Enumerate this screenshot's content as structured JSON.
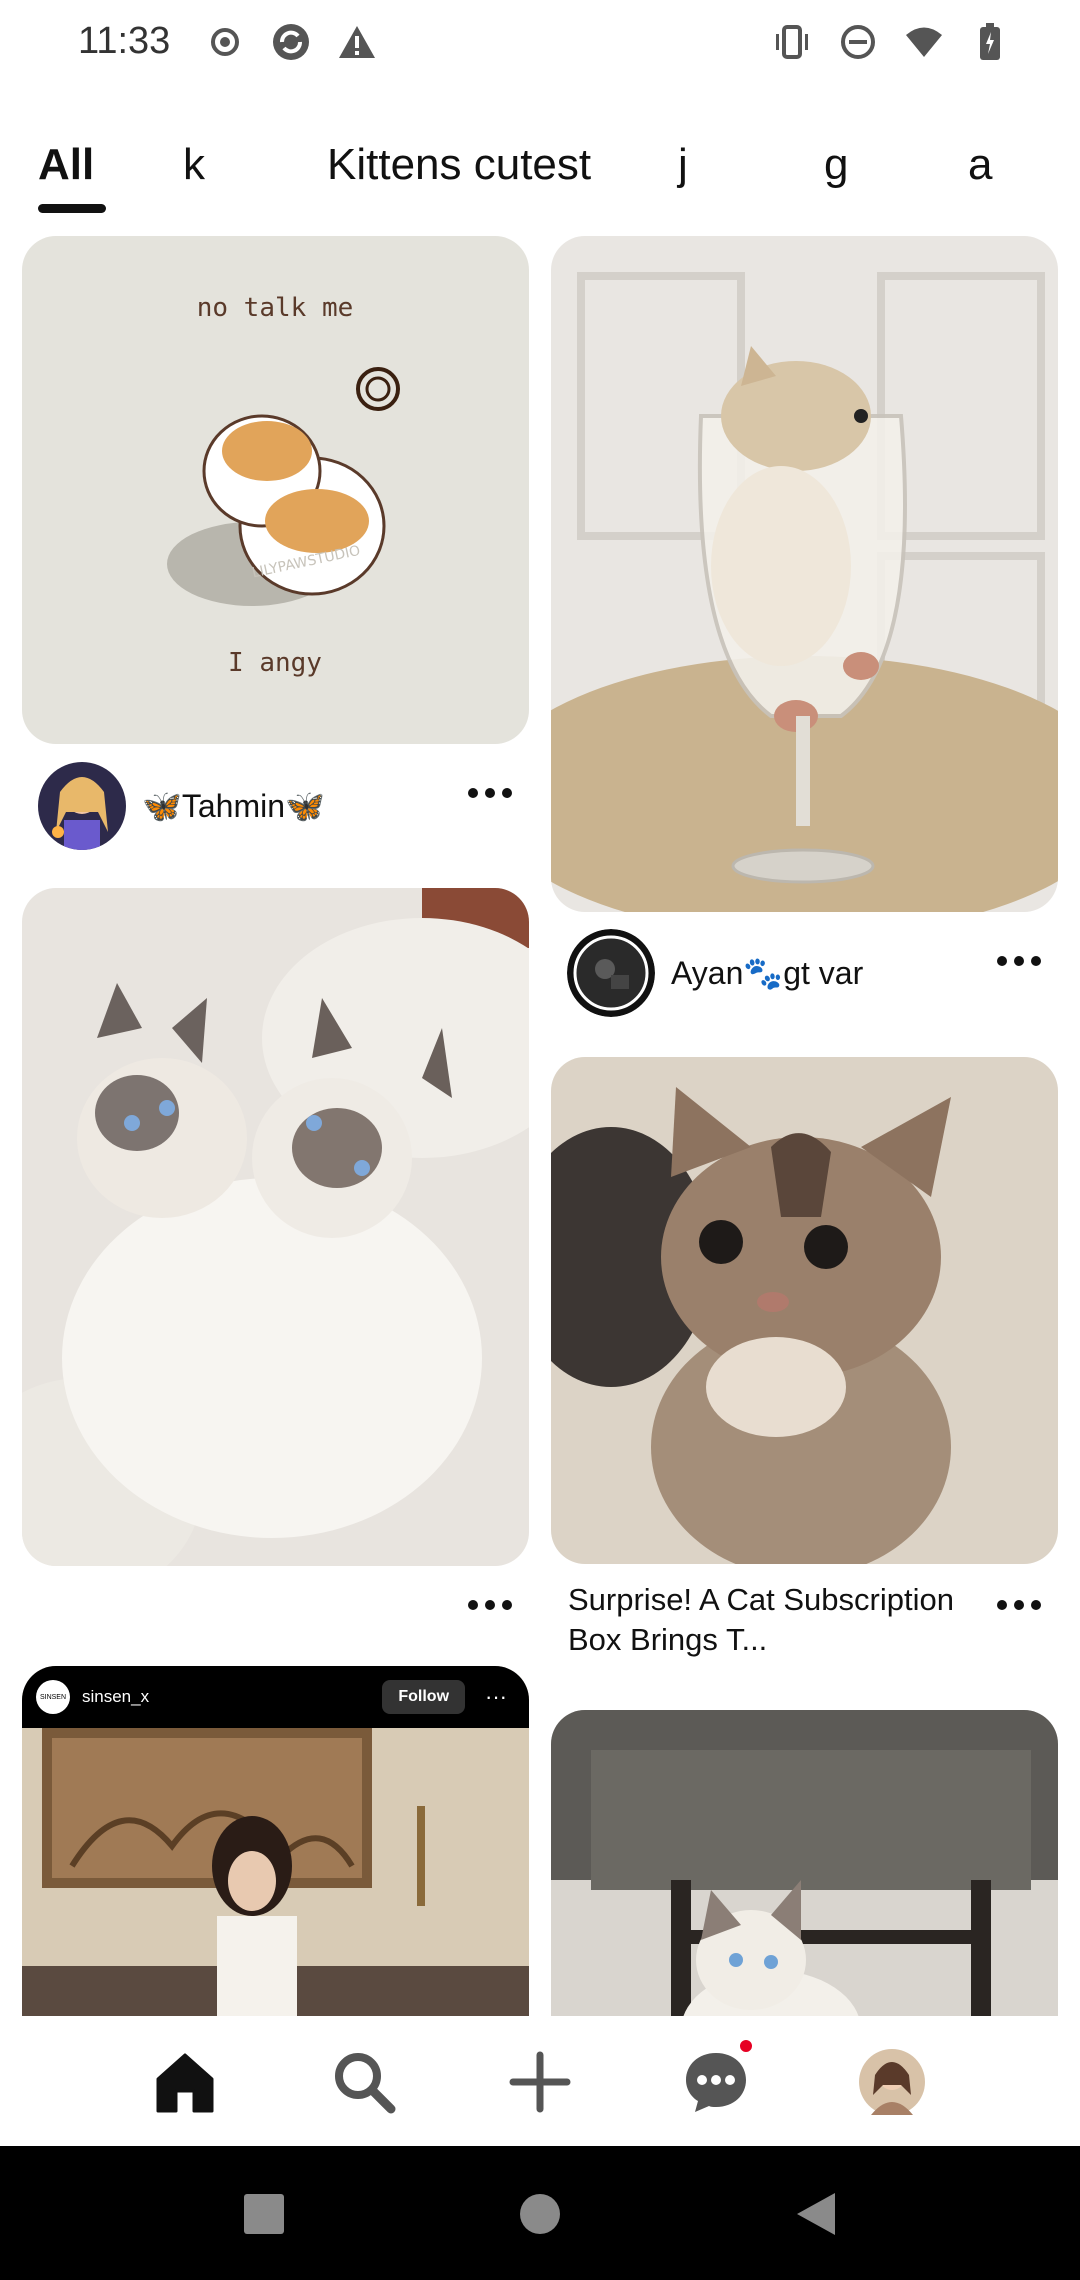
{
  "status_bar": {
    "time": "11:33",
    "left_icons": [
      "record-icon",
      "sync-icon",
      "warning-icon"
    ],
    "right_icons": [
      "vibrate-icon",
      "dnd-icon",
      "wifi-icon",
      "battery-icon"
    ]
  },
  "tabs": [
    {
      "label": "All",
      "active": true
    },
    {
      "label": "k"
    },
    {
      "label": "Kittens cutest"
    },
    {
      "label": "j"
    },
    {
      "label": "g"
    },
    {
      "label": "a"
    }
  ],
  "pins": {
    "p1": {
      "image_text_top": "no talk me",
      "image_text_bottom": "I angy",
      "watermark": "LILYPAWSTUDIO",
      "author": "🦋Tahmin🦋"
    },
    "p2": {
      "author": "Ayan🐾gt var"
    },
    "p3": {},
    "p4": {
      "title": "Surprise! A Cat Subscription Box Brings T..."
    },
    "p5": {
      "account": "sinsen_x",
      "follow_label": "Follow",
      "logo_text": "SINSEN"
    },
    "p6": {}
  },
  "bottom_nav": [
    "home-icon",
    "search-icon",
    "create-icon",
    "messages-icon",
    "profile-avatar"
  ],
  "colors": {
    "accent": "#e60023",
    "text": "#111111",
    "tab_underline": "#111111"
  }
}
